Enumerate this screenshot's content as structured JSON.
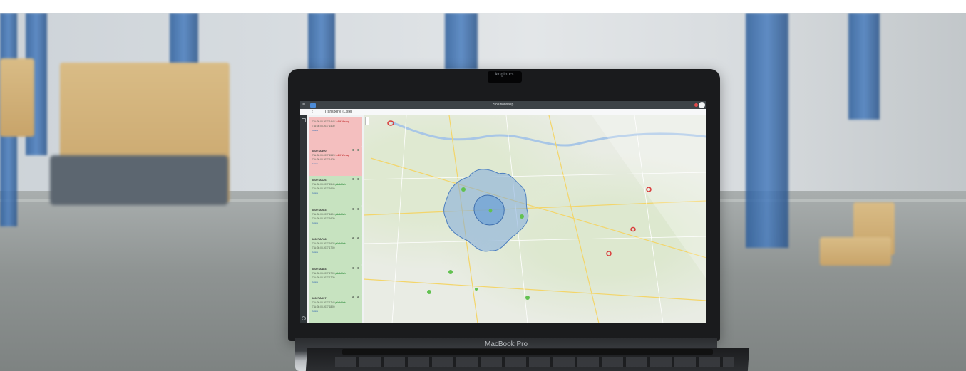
{
  "camera_label": "koginics",
  "laptop_brand": "MacBook Pro",
  "app": {
    "window_title": "Solutionsasp",
    "tab_label": "Transporte (Liste)",
    "menu_icon": "hamburger-icon",
    "back_icon": "back-arrow-icon"
  },
  "colors": {
    "red_card": "#f4bfbf",
    "green_card": "#c7e3c0",
    "isochrone": "#6b9fd6",
    "marker_green": "#62c150",
    "marker_red": "#d93a3a"
  },
  "cards": [
    {
      "status": "red",
      "id": "",
      "line1": "ETA: 30.03.2017 14:43",
      "line1_hl": "1:40h Verzug",
      "line2": "ETA: 30.03.2017 14:30",
      "link": "Details"
    },
    {
      "status": "red",
      "id": "0802TA890",
      "line1": "ETA: 30.03.2017 15:23",
      "line1_hl": "1:40h Verzug",
      "line2": "ETA: 30.03.2017 14:30",
      "link": "Details"
    },
    {
      "status": "green",
      "id": "0802TA626",
      "line1": "ETA: 30.03.2017 15:45",
      "line1_hl": "pünktlich",
      "line2": "ETA: 30.03.2017 16:00",
      "link": "Details"
    },
    {
      "status": "green",
      "id": "0802TA283",
      "line1": "ETA: 30.03.2017 16:10",
      "line1_hl": "pünktlich",
      "line2": "ETA: 30.03.2017 16:30",
      "link": "Details"
    },
    {
      "status": "green",
      "id": "0802TA768",
      "line1": "ETA: 30.03.2017 16:32",
      "line1_hl": "pünktlich",
      "line2": "ETA: 30.03.2017 17:00",
      "link": "Details"
    },
    {
      "status": "green",
      "id": "0802TA484",
      "line1": "ETA: 30.03.2017 17:05",
      "line1_hl": "pünktlich",
      "line2": "ETA: 30.03.2017 17:30",
      "link": "Details"
    },
    {
      "status": "green",
      "id": "0802TA607",
      "line1": "ETA: 30.03.2017 17:48",
      "line1_hl": "pünktlich",
      "line2": "ETA: 30.03.2017 18:00",
      "link": "Details"
    }
  ]
}
